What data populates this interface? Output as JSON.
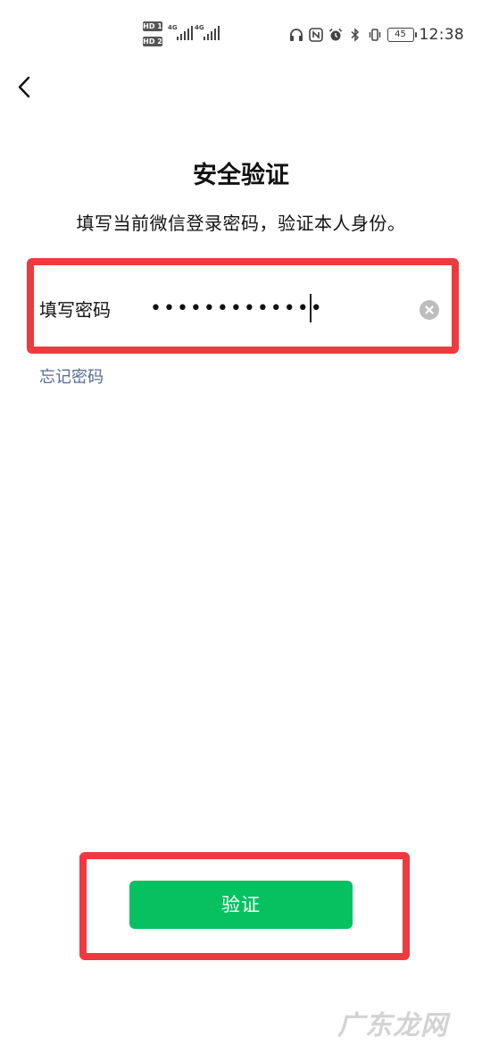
{
  "status_bar": {
    "sim1_tag": "HD 1",
    "sim2_tag": "HD 2",
    "sim1_network": "4G",
    "sim2_network": "4G",
    "battery": "45",
    "time": "12:38",
    "icons": [
      "headphones-icon",
      "nfc-icon",
      "alarm-icon",
      "bluetooth-icon",
      "vibrate-icon"
    ]
  },
  "header": {
    "back_icon": "chevron-left-icon",
    "title": "安全验证",
    "subtitle": "填写当前微信登录密码，验证本人身份。"
  },
  "password_field": {
    "label": "填写密码",
    "value": "•••••••••••••",
    "clear_icon": "clear-circle-icon"
  },
  "forgot_password": "忘记密码",
  "verify_button": {
    "label": "验证",
    "color": "#07c160"
  },
  "annotation_color": "#ee3a3e",
  "watermark": "广东龙网"
}
